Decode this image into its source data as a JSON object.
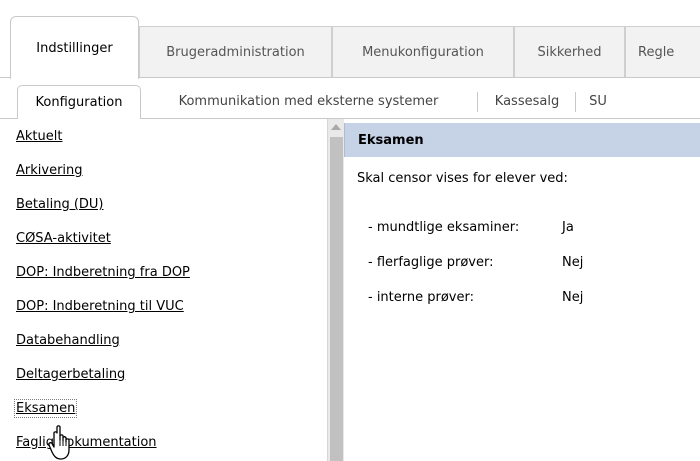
{
  "top_tabs": [
    {
      "label": "Indstillinger",
      "active": true
    },
    {
      "label": "Brugeradministration",
      "active": false
    },
    {
      "label": "Menukonfiguration",
      "active": false
    },
    {
      "label": "Sikkerhed",
      "active": false
    },
    {
      "label": "Regle",
      "active": false
    }
  ],
  "sub_tabs": [
    {
      "label": "Konfiguration",
      "active": true
    },
    {
      "label": "Kommunikation med eksterne systemer",
      "active": false
    },
    {
      "label": "Kassesalg",
      "active": false
    },
    {
      "label": "SU",
      "active": false
    }
  ],
  "left_list": [
    {
      "label": "Aktuelt"
    },
    {
      "label": "Arkivering"
    },
    {
      "label": "Betaling (DU)"
    },
    {
      "label": "CØSA-aktivitet"
    },
    {
      "label": "DOP: Indberetning fra DOP"
    },
    {
      "label": "DOP: Indberetning til VUC"
    },
    {
      "label": "Databehandling"
    },
    {
      "label": "Deltagerbetaling"
    },
    {
      "label": "Eksamen",
      "hovered": true
    },
    {
      "label": "Faglig dokumentation"
    }
  ],
  "panel": {
    "title": "Eksamen",
    "question": "Skal censor vises for elever ved:",
    "rows": [
      {
        "label": "- mundtlige eksaminer:",
        "value": "Ja"
      },
      {
        "label": "- flerfaglige prøver:",
        "value": "Nej"
      },
      {
        "label": "- interne prøver:",
        "value": "Nej"
      }
    ]
  },
  "colors": {
    "panel_header_bg": "#c6d3e7",
    "scrollbar_thumb": "#c1c1c1"
  }
}
